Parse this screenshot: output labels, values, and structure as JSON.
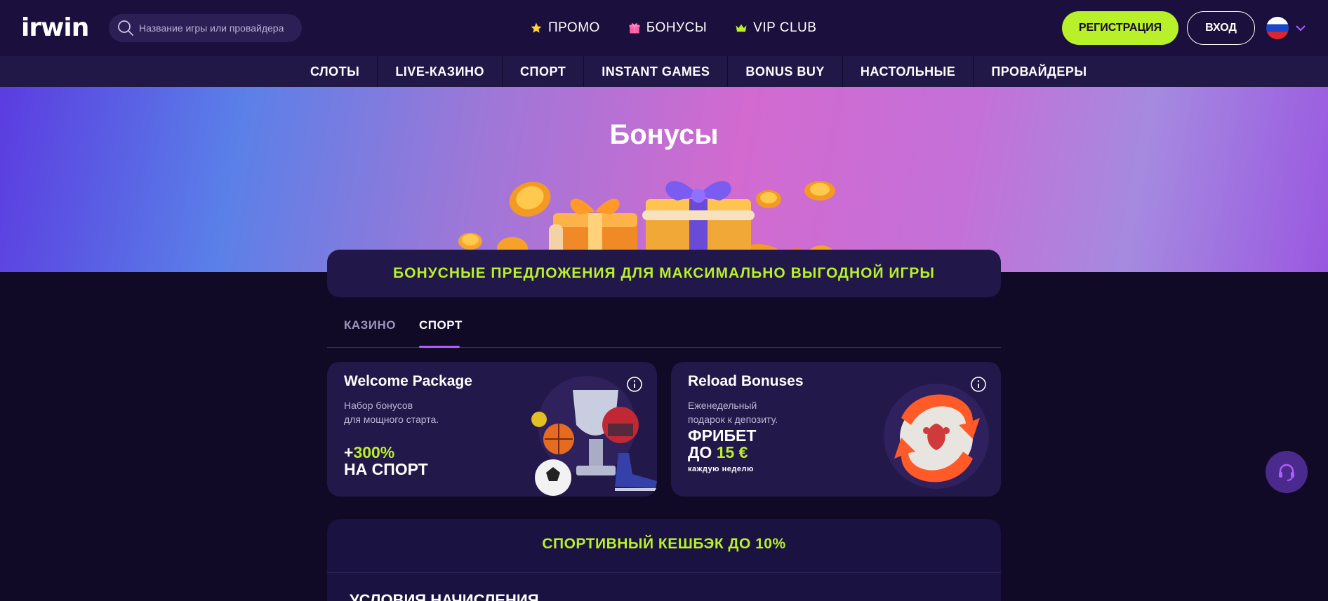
{
  "header": {
    "logo_text": "irwin",
    "search": {
      "placeholder": "Название игры или провайдера"
    },
    "nav": [
      {
        "label": "ПРОМО",
        "icon": "star-icon"
      },
      {
        "label": "БОНУСЫ",
        "icon": "gift-icon"
      },
      {
        "label": "VIP CLUB",
        "icon": "crown-icon"
      }
    ],
    "register_label": "РЕГИСТРАЦИЯ",
    "login_label": "ВХОД",
    "language_icon": "russian-flag-icon"
  },
  "categories": [
    "СЛОТЫ",
    "LIVE-КАЗИНО",
    "СПОРТ",
    "INSTANT GAMES",
    "BONUS BUY",
    "НАСТОЛЬНЫЕ",
    "ПРОВАЙДЕРЫ"
  ],
  "hero": {
    "title": "Бонусы"
  },
  "banner": {
    "text": "БОНУСНЫЕ ПРЕДЛОЖЕНИЯ ДЛЯ МАКСИМАЛЬНО ВЫГОДНОЙ ИГРЫ"
  },
  "tabs": [
    {
      "label": "КАЗИНО",
      "active": false
    },
    {
      "label": "СПОРТ",
      "active": true
    }
  ],
  "cards": [
    {
      "title": "Welcome Package",
      "desc_line1": "Набор бонусов",
      "desc_line2": "для мощного старта.",
      "big_prefix": "+",
      "big_accent": "300%",
      "big_line2": "НА СПОРТ"
    },
    {
      "title": "Reload Bonuses",
      "desc_line1": "Еженедельный",
      "desc_line2": "подарок к депозиту.",
      "big_line1": "ФРИБЕТ",
      "big_prefix2": "ДО ",
      "big_accent2": "15 €",
      "small": "каждую неделю"
    }
  ],
  "cashback": {
    "title": "СПОРТИВНЫЙ КЕШБЭК ДО 10%",
    "subtitle": "Условия начисления"
  },
  "colors": {
    "accent_lime": "#b8f02a",
    "background": "#110a26",
    "header_bg": "#1b0f3d",
    "tab_underline": "#b25cff"
  }
}
